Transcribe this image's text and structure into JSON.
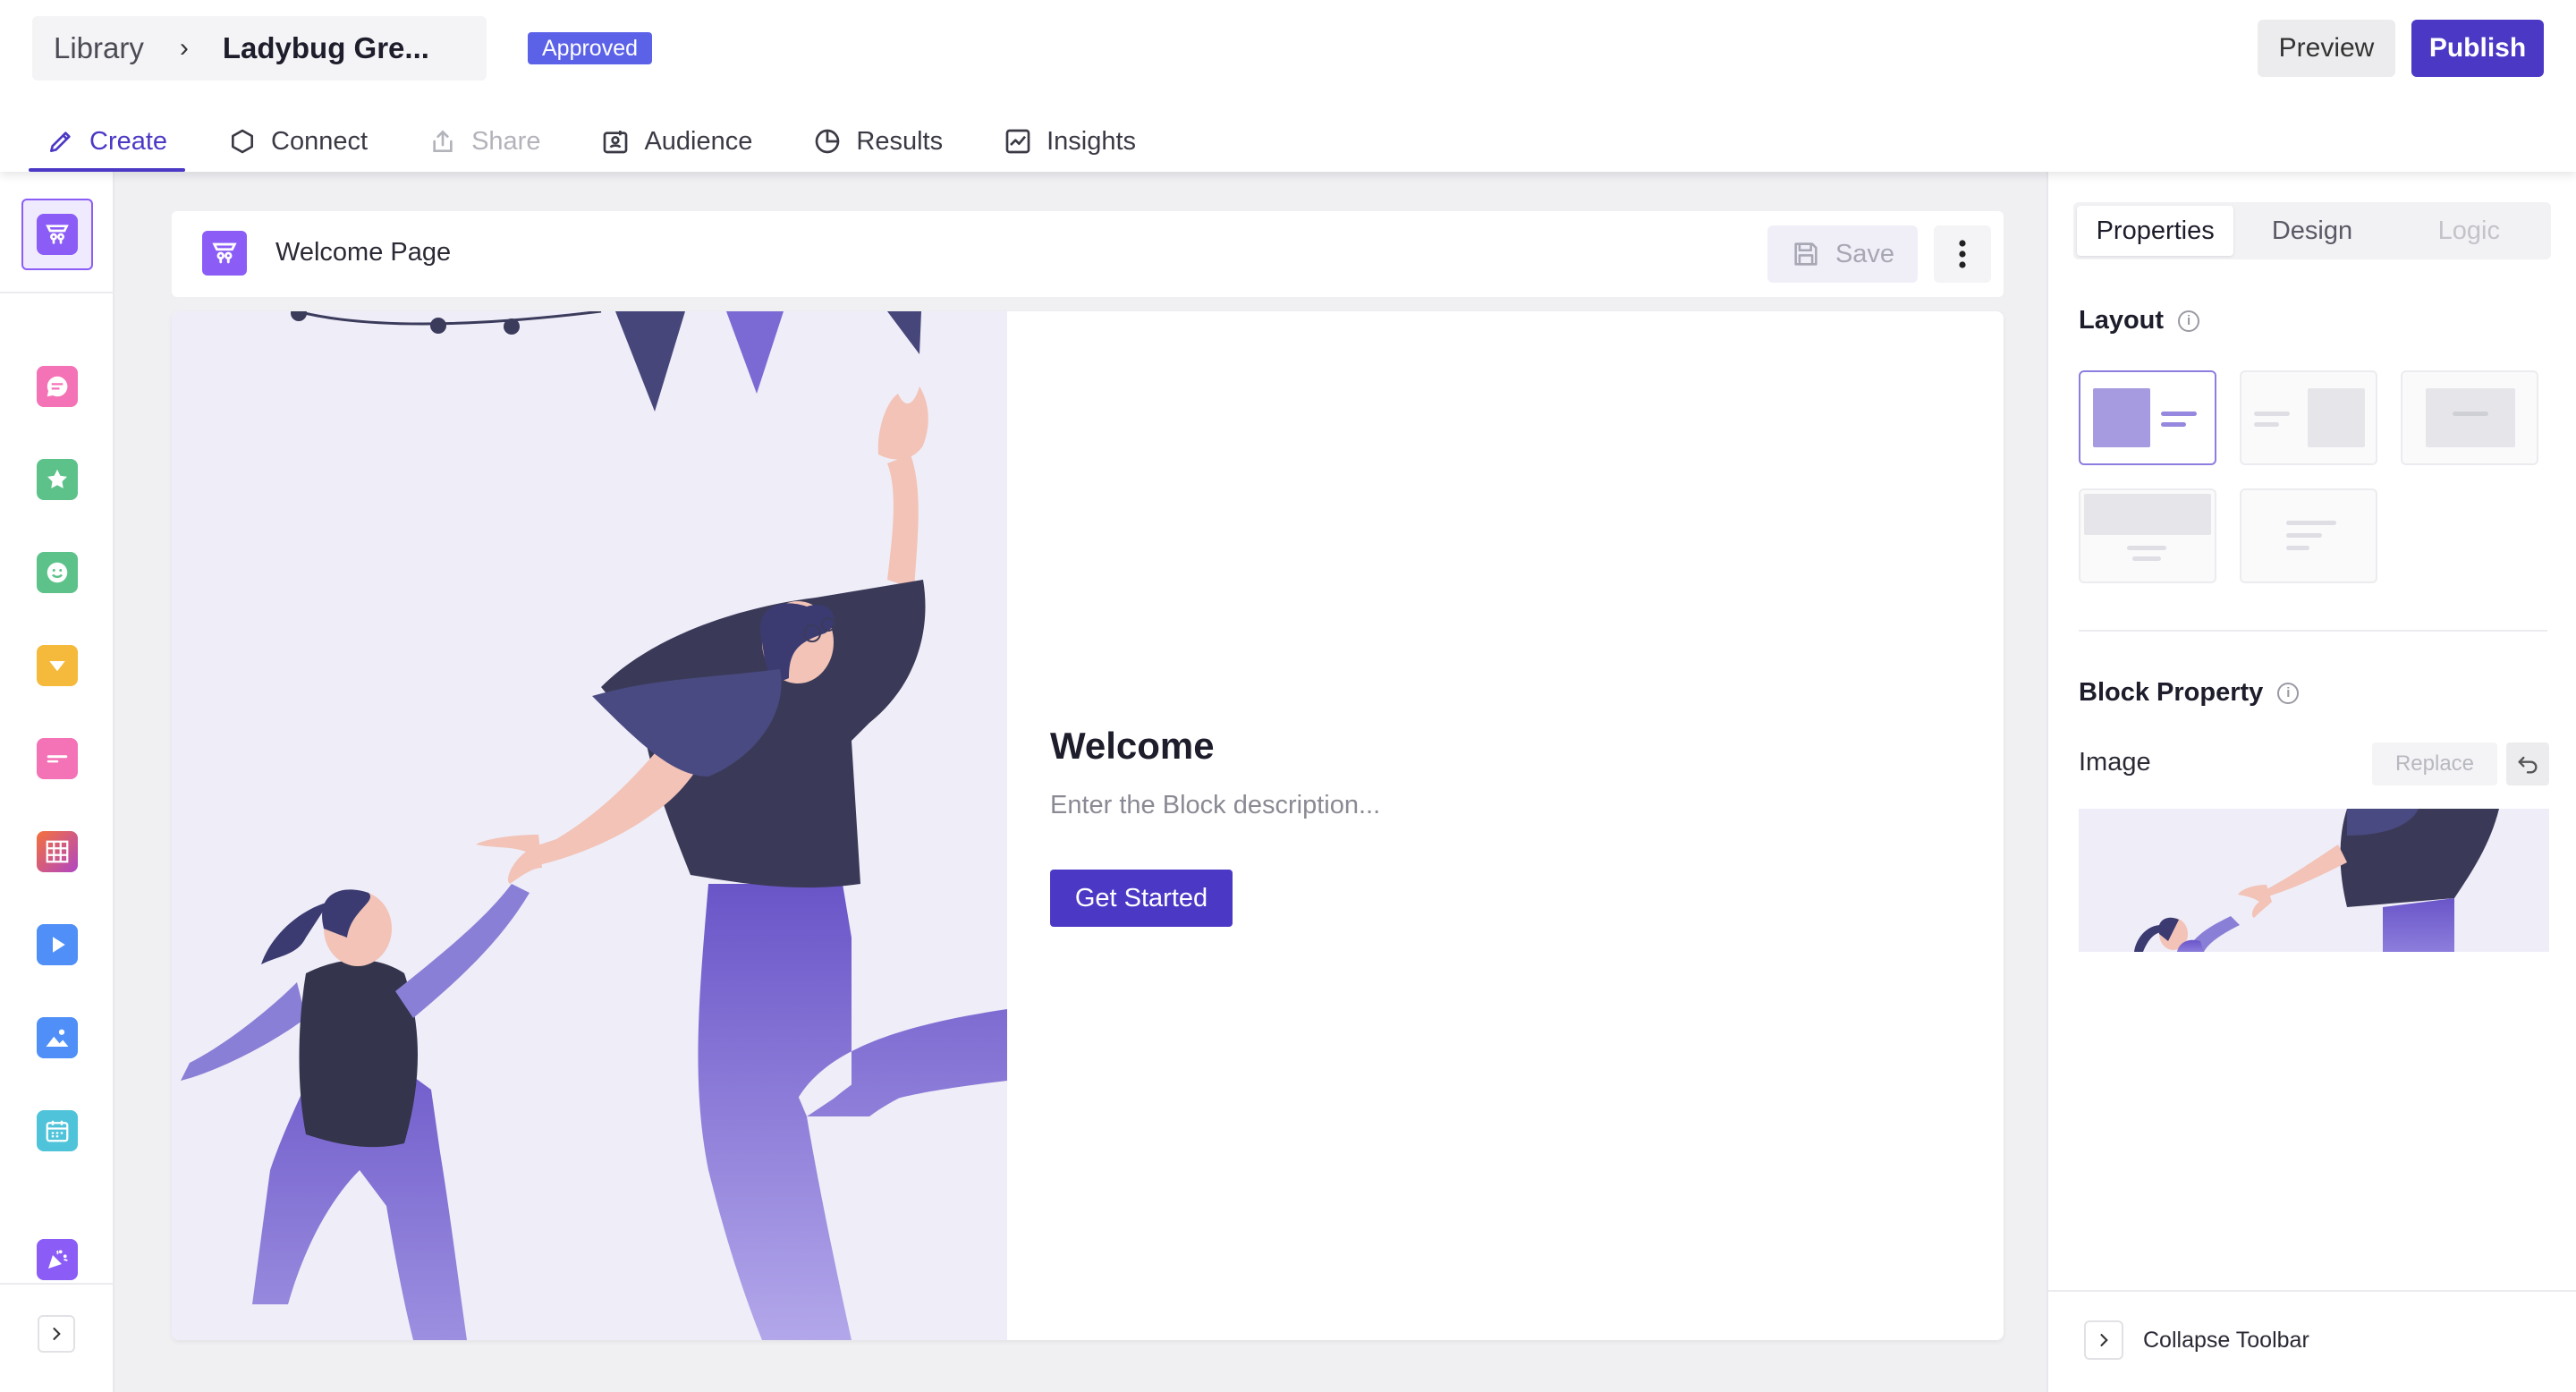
{
  "header": {
    "breadcrumb_root": "Library",
    "breadcrumb_sep": "›",
    "breadcrumb_current": "Ladybug Gre...",
    "status_badge": "Approved",
    "preview_label": "Preview",
    "publish_label": "Publish"
  },
  "tabs": [
    {
      "label": "Create",
      "icon": "pencil-icon",
      "state": "active"
    },
    {
      "label": "Connect",
      "icon": "hexagon-icon",
      "state": "normal"
    },
    {
      "label": "Share",
      "icon": "share-icon",
      "state": "disabled"
    },
    {
      "label": "Audience",
      "icon": "audience-icon",
      "state": "normal"
    },
    {
      "label": "Results",
      "icon": "pie-chart-icon",
      "state": "normal"
    },
    {
      "label": "Insights",
      "icon": "trend-chart-icon",
      "state": "normal"
    }
  ],
  "left_toolbar": {
    "items": [
      {
        "icon": "welcome-block-icon",
        "color": "#8b5cf6"
      },
      {
        "icon": "chat-block-icon",
        "color": "#f472b6"
      },
      {
        "icon": "star-rating-icon",
        "color": "#5cc28a"
      },
      {
        "icon": "smiley-icon",
        "color": "#5cc28a"
      },
      {
        "icon": "dropdown-icon",
        "color": "#f5b93c"
      },
      {
        "icon": "text-input-icon",
        "color": "#f472b6"
      },
      {
        "icon": "matrix-grid-icon",
        "color": "#f5713c"
      },
      {
        "icon": "video-icon",
        "color": "#4f8ff7"
      },
      {
        "icon": "image-icon",
        "color": "#4f8ff7"
      },
      {
        "icon": "calendar-icon",
        "color": "#4fc3d9"
      },
      {
        "icon": "thank-you-icon",
        "color": "#8b5cf6"
      }
    ]
  },
  "page_bar": {
    "title": "Welcome Page",
    "save_label": "Save"
  },
  "block": {
    "title": "Welcome",
    "description": "Enter the Block description...",
    "button_label": "Get Started"
  },
  "right_panel": {
    "tabs": [
      {
        "label": "Properties",
        "state": "active"
      },
      {
        "label": "Design",
        "state": "normal"
      },
      {
        "label": "Logic",
        "state": "disabled"
      }
    ],
    "layout_title": "Layout",
    "block_property_title": "Block Property",
    "image_label": "Image",
    "replace_label": "Replace",
    "collapse_label": "Collapse Toolbar"
  },
  "colors": {
    "accent": "#4b39c6",
    "badge": "#5b62e8",
    "illustration_bg": "#efedf8"
  }
}
